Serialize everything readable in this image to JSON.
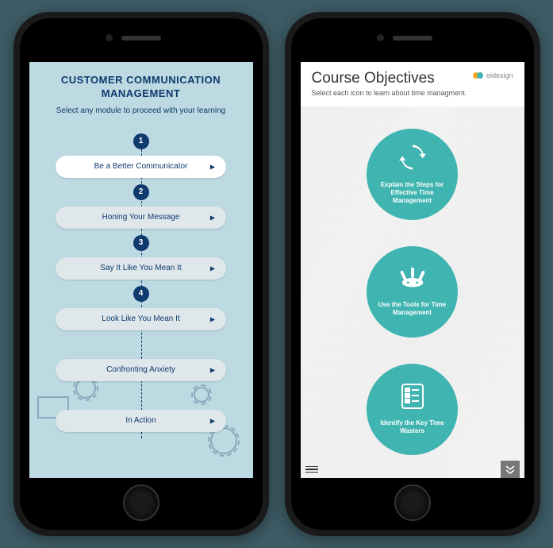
{
  "screen1": {
    "title": "CUSTOMER COMMUNICATION MANAGEMENT",
    "subtitle": "Select any module to proceed with your learning",
    "modules": [
      {
        "num": "1",
        "label": "Be a Better Communicator",
        "active": true
      },
      {
        "num": "2",
        "label": "Honing Your Message",
        "active": false
      },
      {
        "num": "3",
        "label": "Say It Like You Mean It",
        "active": false
      },
      {
        "num": "4",
        "label": "Look Like You Mean It",
        "active": false
      },
      {
        "num": "",
        "label": "Confronting Anxiety",
        "active": false
      },
      {
        "num": "",
        "label": "In Action",
        "active": false
      }
    ]
  },
  "screen2": {
    "title": "Course Objectives",
    "subtitle": "Select each icon to learn about time managment.",
    "brand": "eidesign",
    "objectives": [
      {
        "icon": "cycle",
        "label": "Explain the Steps for Effective Time Management"
      },
      {
        "icon": "tools",
        "label": "Use the Tools for Time Management"
      },
      {
        "icon": "checklist",
        "label": "Identify the Key Time Wasters"
      }
    ]
  },
  "colors": {
    "navy": "#0e3a6e",
    "teal": "#3fb4b0",
    "lightblue": "#bdd9e1"
  }
}
